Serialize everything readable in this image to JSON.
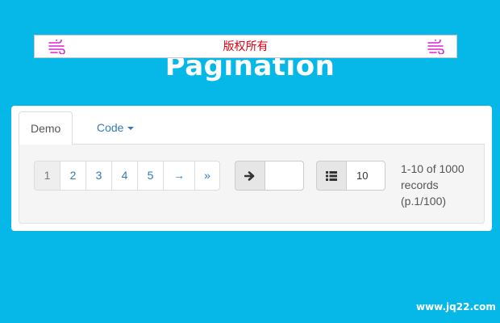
{
  "page": {
    "title": "Pagination"
  },
  "copyright": {
    "text": "版权所有",
    "icon": "wind-icon",
    "color": "#e60012"
  },
  "tabs": [
    {
      "label": "Demo",
      "active": true
    },
    {
      "label": "Code",
      "dropdown": true
    }
  ],
  "pagination": {
    "pages": [
      "1",
      "2",
      "3",
      "4",
      "5"
    ],
    "current": "1",
    "next_label": "→",
    "last_label": "»"
  },
  "jump": {
    "icon": "arrow-right-icon",
    "value": ""
  },
  "page_size": {
    "icon": "list-icon",
    "value": "10"
  },
  "records": {
    "line1": "1-10 of 1000",
    "line2": "records",
    "line3": "(p.1/100)"
  },
  "watermark": {
    "text": "www.jq22.com"
  },
  "colors": {
    "background": "#05b8e8",
    "link": "#337ab7",
    "panel": "#f5f5f5"
  }
}
